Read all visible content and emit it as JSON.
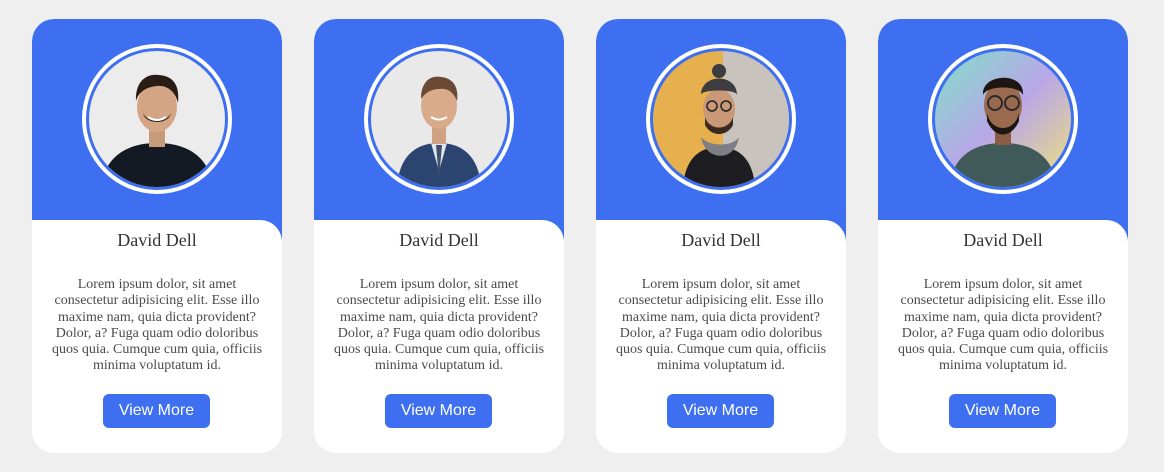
{
  "theme": {
    "accent": "#3d6ff0",
    "background": "#efefef"
  },
  "cards": [
    {
      "name": "David Dell",
      "bio": "Lorem ipsum dolor, sit amet consectetur adipisicing elit. Esse illo maxime nam, quia dicta provident? Dolor, a? Fuga quam odio doloribus quos quia. Cumque cum quia, officiis minima voluptatum id.",
      "button_label": "View More",
      "avatar_icon": "person-photo-icon"
    },
    {
      "name": "David Dell",
      "bio": "Lorem ipsum dolor, sit amet consectetur adipisicing elit. Esse illo maxime nam, quia dicta provident? Dolor, a? Fuga quam odio doloribus quos quia. Cumque cum quia, officiis minima voluptatum id.",
      "button_label": "View More",
      "avatar_icon": "person-photo-icon"
    },
    {
      "name": "David Dell",
      "bio": "Lorem ipsum dolor, sit amet consectetur adipisicing elit. Esse illo maxime nam, quia dicta provident? Dolor, a? Fuga quam odio doloribus quos quia. Cumque cum quia, officiis minima voluptatum id.",
      "button_label": "View More",
      "avatar_icon": "person-photo-icon"
    },
    {
      "name": "David Dell",
      "bio": "Lorem ipsum dolor, sit amet consectetur adipisicing elit. Esse illo maxime nam, quia dicta provident? Dolor, a? Fuga quam odio doloribus quos quia. Cumque cum quia, officiis minima voluptatum id.",
      "button_label": "View More",
      "avatar_icon": "person-photo-icon"
    }
  ]
}
